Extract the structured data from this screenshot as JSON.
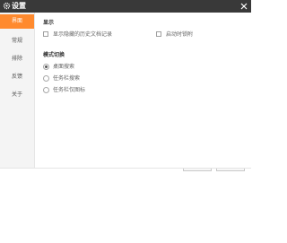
{
  "window": {
    "title": "设置",
    "title_icon": "gear-icon",
    "close_icon": "close-icon"
  },
  "sidebar": {
    "items": [
      {
        "label": "界面",
        "active": true
      },
      {
        "label": "常规",
        "active": false
      },
      {
        "label": "排除",
        "active": false
      },
      {
        "label": "反馈",
        "active": false
      },
      {
        "label": "关于",
        "active": false
      }
    ]
  },
  "display_section": {
    "title": "显示",
    "options": [
      {
        "label": "显示隐藏的历史文档记录",
        "checked": false
      },
      {
        "label": "启动时锁附",
        "checked": false
      }
    ]
  },
  "mode_section": {
    "title": "模式切换",
    "options": [
      {
        "label": "桌面搜索",
        "selected": true
      },
      {
        "label": "任务栏搜索",
        "selected": false
      },
      {
        "label": "任务栏仅图标",
        "selected": false
      }
    ]
  },
  "colors": {
    "titlebar": "#393939",
    "accent": "#ff8a2e",
    "sidebar_bg": "#f4f4f4"
  }
}
